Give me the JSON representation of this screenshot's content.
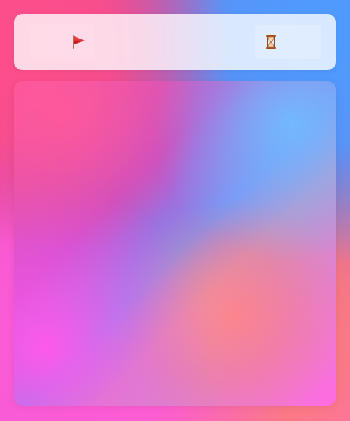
{
  "hud": {
    "flags_icon": "flag-icon",
    "timer_icon": "hourglass-icon",
    "flags_value": "",
    "timer_value": ""
  },
  "board": {
    "state": "blank-gradient-board"
  },
  "colors": {
    "hud_background": "#ffffffc7",
    "board_pink": "#ff4e98",
    "board_blue": "#6fb7ff",
    "board_magenta": "#ff58ea",
    "board_coral": "#ff7b81",
    "flag_red": "#c91f22",
    "hourglass_brown": "#a44d1c",
    "hourglass_sand": "#f0b56e"
  }
}
